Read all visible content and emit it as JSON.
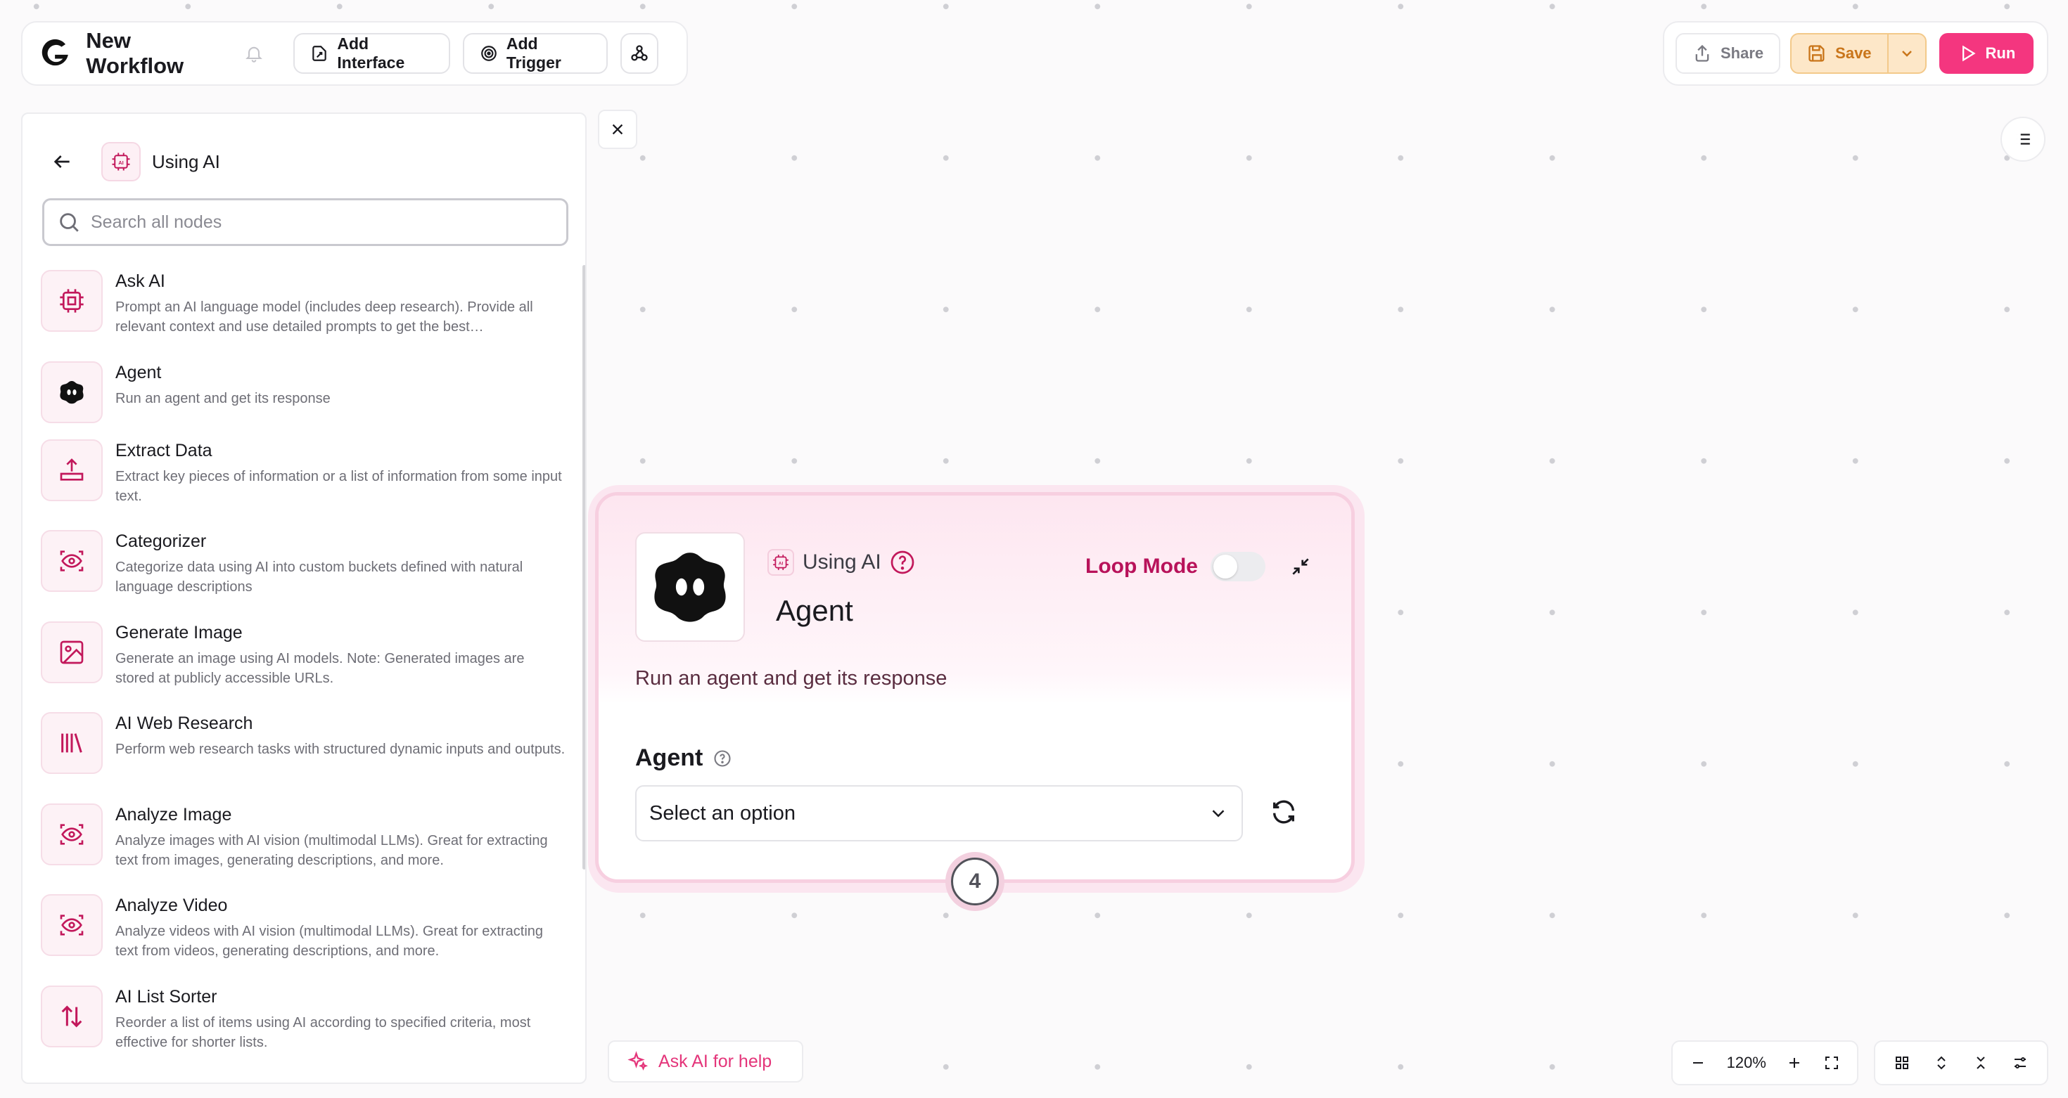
{
  "header": {
    "title": "New Workflow",
    "add_interface_label": "Add Interface",
    "add_trigger_label": "Add Trigger",
    "share_label": "Share",
    "save_label": "Save",
    "run_label": "Run"
  },
  "panel": {
    "title": "Using AI",
    "search_placeholder": "Search all nodes",
    "nodes": [
      {
        "title": "Ask AI",
        "description": "Prompt an AI language model (includes deep research). Provide all relevant context and use detailed prompts to get the best…",
        "icon": "cpu-icon"
      },
      {
        "title": "Agent",
        "description": "Run an agent and get its response",
        "icon": "agent-blob-icon"
      },
      {
        "title": "Extract Data",
        "description": "Extract key pieces of information or a list of information from some input text.",
        "icon": "extract-icon"
      },
      {
        "title": "Categorizer",
        "description": "Categorize data using AI into custom buckets defined with natural language descriptions",
        "icon": "eye-scan-icon"
      },
      {
        "title": "Generate Image",
        "description": "Generate an image using AI models. Note: Generated images are stored at publicly accessible URLs.",
        "icon": "image-icon"
      },
      {
        "title": "AI Web Research",
        "description": "Perform web research tasks with structured dynamic inputs and outputs.",
        "icon": "library-icon"
      },
      {
        "title": "Analyze Image",
        "description": "Analyze images with AI vision (multimodal LLMs). Great for extracting text from images, generating descriptions, and more.",
        "icon": "eye-scan-icon"
      },
      {
        "title": "Analyze Video",
        "description": "Analyze videos with AI vision (multimodal LLMs). Great for extracting text from videos, generating descriptions, and more.",
        "icon": "eye-scan-icon"
      },
      {
        "title": "AI List Sorter",
        "description": "Reorder a list of items using AI according to specified criteria, most effective for shorter lists.",
        "icon": "sort-arrows-icon"
      }
    ]
  },
  "node_card": {
    "category": "Using AI",
    "title": "Agent",
    "loop_mode_label": "Loop Mode",
    "loop_mode_on": false,
    "description": "Run an agent and get its response",
    "field_label": "Agent",
    "select_value": "Select an option",
    "step_number": "4"
  },
  "ask_ai_label": "Ask AI for help",
  "zoom": {
    "level": "120%"
  },
  "colors": {
    "accent": "#f4367f",
    "icon_pink": "#c2185b",
    "save_bg": "#fde7c8",
    "save_text": "#c9751a"
  }
}
